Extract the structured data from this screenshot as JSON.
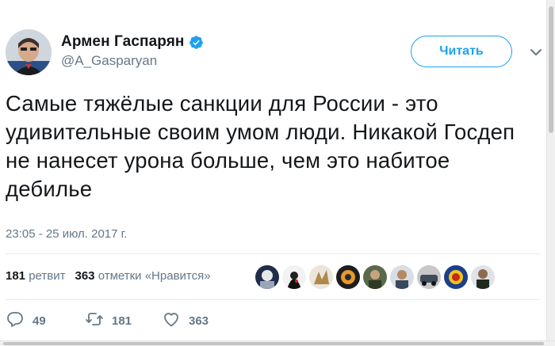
{
  "author": {
    "name": "Армен Гаспарян",
    "handle": "@A_Gasparyan",
    "verified": true
  },
  "header": {
    "follow_label": "Читать"
  },
  "tweet": {
    "text": "Самые тяжёлые санкции для России - это удивительные своим умом люди. Никакой Госдеп не нанесет урона больше, чем это набитое дебилье",
    "timestamp": "23:05 - 25 июл. 2017 г."
  },
  "stats": {
    "retweets_count": "181",
    "retweets_label": "ретвит",
    "likes_count": "363",
    "likes_label": "отметки «Нравится»"
  },
  "actions": {
    "reply_count": "49",
    "retweet_count": "181",
    "like_count": "363"
  },
  "colors": {
    "accent": "#1da1f2",
    "verified": "#1da1f2",
    "muted_text": "#657786",
    "text": "#14171a",
    "divider": "#e6ecf0"
  },
  "icons": [
    "verified-badge-icon",
    "chevron-down-icon",
    "reply-icon",
    "retweet-icon",
    "heart-icon"
  ]
}
